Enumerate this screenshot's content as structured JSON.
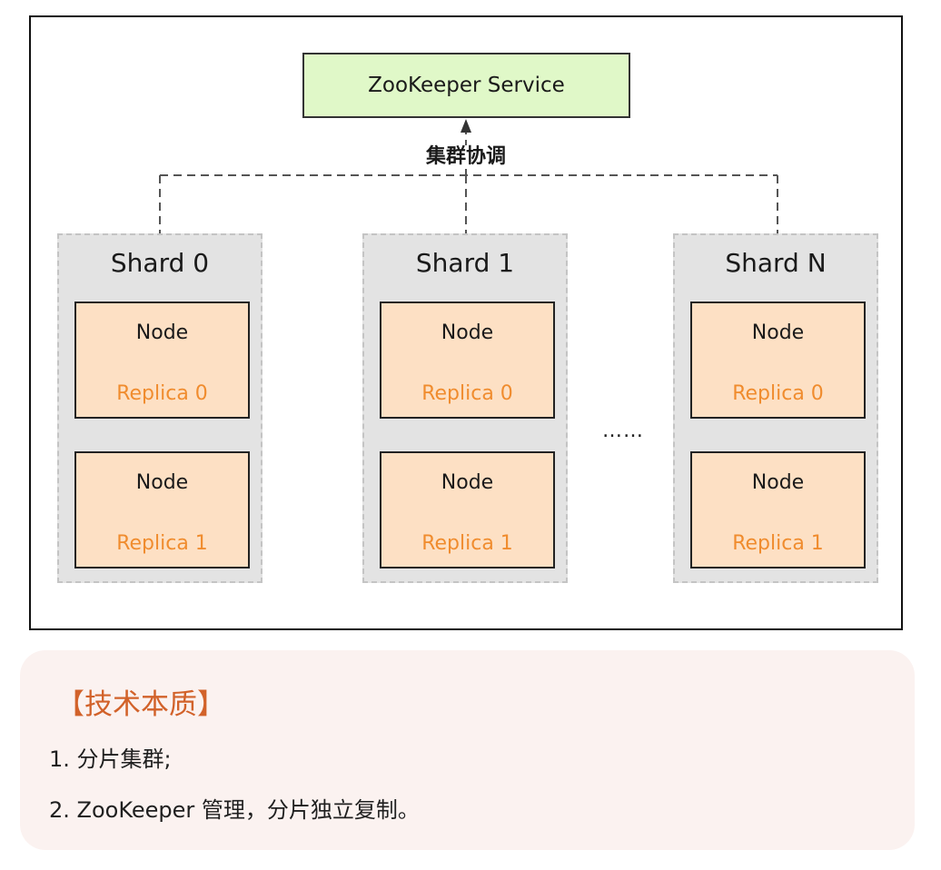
{
  "zookeeper": {
    "label": "ZooKeeper Service"
  },
  "coordination_label": "集群协调",
  "shards": [
    {
      "title": "Shard 0",
      "nodes": [
        {
          "label": "Node",
          "replica": "Replica 0"
        },
        {
          "label": "Node",
          "replica": "Replica 1"
        }
      ]
    },
    {
      "title": "Shard 1",
      "nodes": [
        {
          "label": "Node",
          "replica": "Replica 0"
        },
        {
          "label": "Node",
          "replica": "Replica 1"
        }
      ]
    },
    {
      "title": "Shard N",
      "nodes": [
        {
          "label": "Node",
          "replica": "Replica 0"
        },
        {
          "label": "Node",
          "replica": "Replica 1"
        }
      ]
    }
  ],
  "ellipsis": "……",
  "colors": {
    "zookeeper_fill": "#e0f8c8",
    "shard_fill": "#e3e3e3",
    "node_fill": "#fde0c4",
    "replica_text": "#f08c2e",
    "note_background": "#fbf2f0",
    "note_title": "#d2622a"
  },
  "note": {
    "title": "【技术本质】",
    "items": [
      "1. 分片集群;",
      "2. ZooKeeper 管理，分片独立复制。"
    ]
  }
}
